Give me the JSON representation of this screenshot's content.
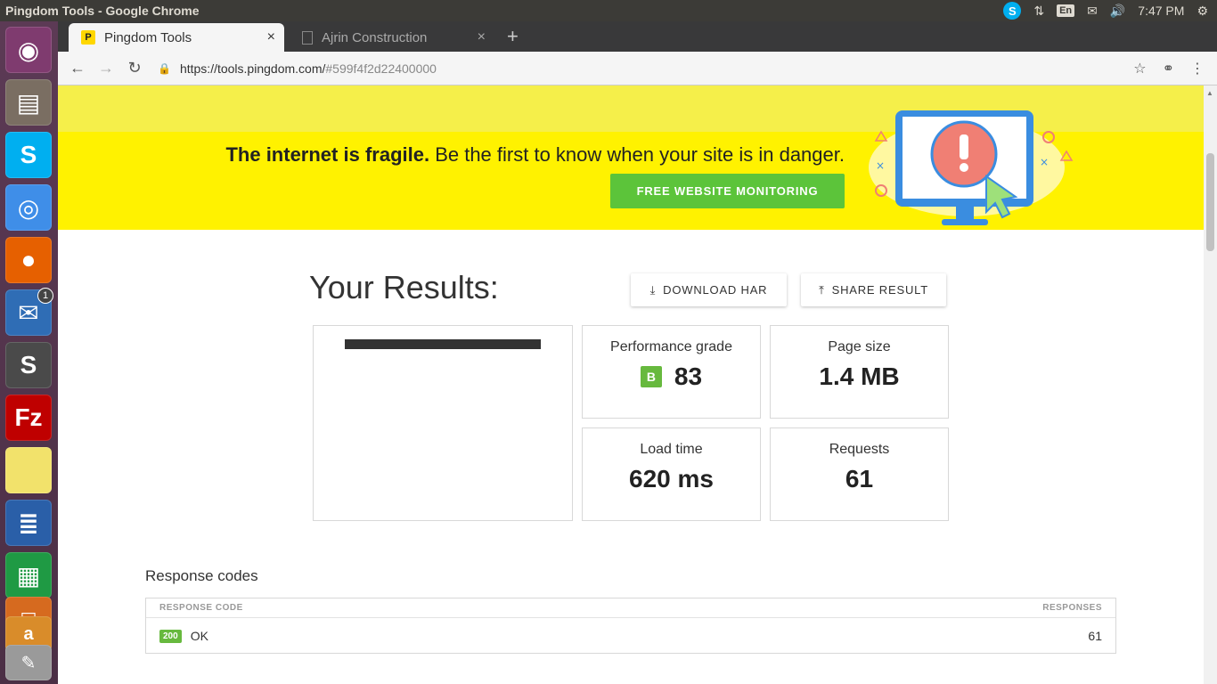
{
  "system": {
    "window_title": "Pingdom Tools - Google Chrome",
    "keyboard_lang": "En",
    "clock": "7:47 PM"
  },
  "launcher": {
    "items": [
      {
        "name": "ubuntu-dash",
        "glyph": "◉",
        "color": "#7f3b6f"
      },
      {
        "name": "files",
        "glyph": "▤",
        "color": "#7a6e62"
      },
      {
        "name": "skype",
        "glyph": "S",
        "color": "#00aff0"
      },
      {
        "name": "chrome",
        "glyph": "◎",
        "color": "#3f8ee8"
      },
      {
        "name": "firefox",
        "glyph": "●",
        "color": "#e66000"
      },
      {
        "name": "thunderbird",
        "glyph": "✉",
        "color": "#2f6db5"
      },
      {
        "name": "sublime-text",
        "glyph": "S",
        "color": "#4a4a4a"
      },
      {
        "name": "filezilla",
        "glyph": "Fz",
        "color": "#bf0000"
      },
      {
        "name": "sticky-notes",
        "glyph": "",
        "color": "#f2e26b"
      },
      {
        "name": "libreoffice-writer",
        "glyph": "≣",
        "color": "#2a5fa8"
      },
      {
        "name": "libreoffice-calc",
        "glyph": "▦",
        "color": "#1f9a44"
      },
      {
        "name": "libreoffice-impress",
        "glyph": "▭",
        "color": "#d66a1f"
      },
      {
        "name": "amazon",
        "glyph": "a",
        "color": "#d98c2a"
      },
      {
        "name": "text-editor",
        "glyph": "✎",
        "color": "#9a9a9a"
      }
    ],
    "thunderbird_badge": "1"
  },
  "browser": {
    "tabs": [
      {
        "label": "Pingdom Tools",
        "active": true
      },
      {
        "label": "Ajrin Construction",
        "active": false
      }
    ],
    "url_main": "https://tools.pingdom.com/",
    "url_hash": "#599f4f2d22400000"
  },
  "banner": {
    "headline_bold": "The internet is fragile.",
    "headline_rest": " Be the first to know when your site is in danger.",
    "cta": "FREE WEBSITE MONITORING"
  },
  "results": {
    "title": "Your Results:",
    "download_har": "DOWNLOAD HAR",
    "share_result": "SHARE RESULT",
    "stats": {
      "performance": {
        "label": "Performance grade",
        "grade": "B",
        "value": "83"
      },
      "page_size": {
        "label": "Page size",
        "value": "1.4 MB"
      },
      "load_time": {
        "label": "Load time",
        "value": "620 ms"
      },
      "requests": {
        "label": "Requests",
        "value": "61"
      }
    }
  },
  "response_codes": {
    "title": "Response codes",
    "col_code": "RESPONSE CODE",
    "col_responses": "RESPONSES",
    "rows": [
      {
        "code": "200",
        "text": "OK",
        "count": "61"
      }
    ]
  }
}
